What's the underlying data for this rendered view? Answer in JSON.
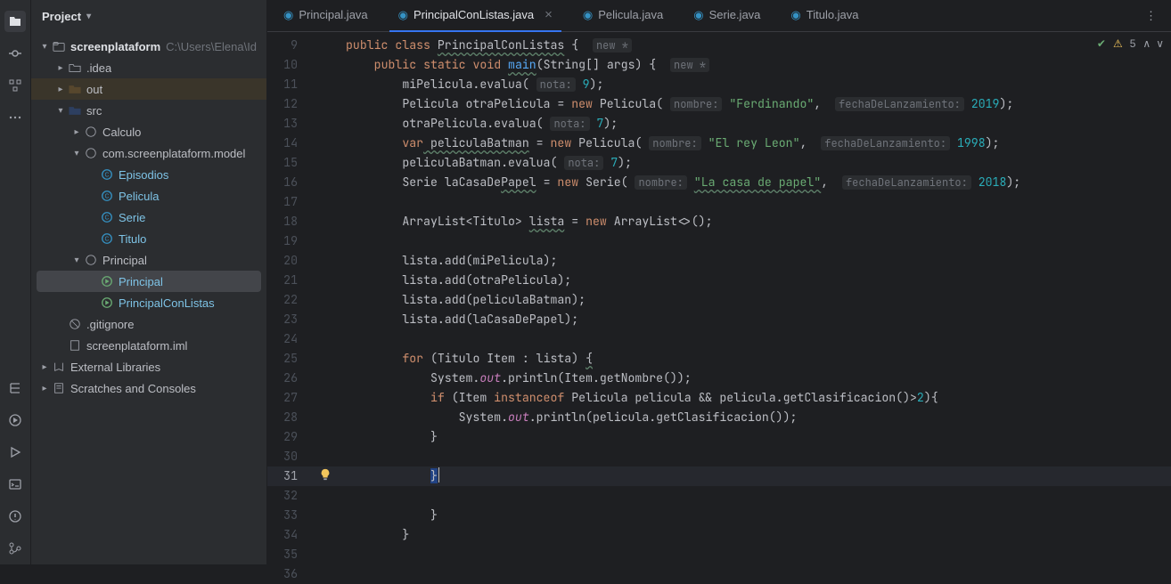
{
  "panel": {
    "title": "Project"
  },
  "tree": {
    "root": {
      "name": "screenplataform",
      "path": "C:\\Users\\Elena\\Id"
    },
    "idea": ".idea",
    "out": "out",
    "src": "src",
    "calculo": "Calculo",
    "model": "com.screenplataform.model",
    "episodios": "Episodios",
    "pelicula": "Pelicula",
    "serie": "Serie",
    "titulo": "Titulo",
    "principalFolder": "Principal",
    "principal": "Principal",
    "princListas": "PrincipalConListas",
    "gitignore": ".gitignore",
    "iml": "screenplataform.iml",
    "extlib": "External Libraries",
    "scratches": "Scratches and Consoles"
  },
  "tabs": {
    "t1": "Principal.java",
    "t2": "PrincipalConListas.java",
    "t3": "Pelicula.java",
    "t4": "Serie.java",
    "t5": "Titulo.java"
  },
  "indicators": {
    "warn_count": "5"
  },
  "hints": {
    "new": "new *",
    "nota": "nota:",
    "nombre": "nombre:",
    "fecha": "fechaDeLanzamiento:"
  },
  "code": {
    "l9a": "public",
    "l9b": "class",
    "l9c": "PrincipalConListas",
    "l9d": " {",
    "l10a": "public",
    "l10b": "static",
    "l10c": "void",
    "l10d": "main",
    "l10e": "(String[] args) {",
    "l11b": "miPelicula.evalua(",
    "l11n": "9",
    "l11c": ");",
    "l12a": "Pelicula otraPelicula = ",
    "l12b": "new",
    "l12c": " Pelicula(",
    "l12s": "\"Ferdinando\"",
    "l12d": ", ",
    "l12n": "2019",
    "l12e": ");",
    "l13a": "otraPelicula.evalua(",
    "l13n": "7",
    "l13b": ");",
    "l14a": "var",
    "l14b": " peliculaBatman",
    "l14c": " = ",
    "l14d": "new",
    "l14e": " Pelicula(",
    "l14s": "\"El rey Leon\"",
    "l14f": ", ",
    "l14n": "1998",
    "l14g": ");",
    "l15a": "peliculaBatman.evalua(",
    "l15n": "7",
    "l15b": ");",
    "l16a": "Serie laCasaDe",
    "l16u": "Papel",
    "l16b": " = ",
    "l16c": "new",
    "l16d": " Serie(",
    "l16s": "\"La casa de papel\"",
    "l16e": ", ",
    "l16n": "2018",
    "l16f": ");",
    "l18a": "ArrayList<Titulo> ",
    "l18u": "lista",
    "l18b": " = ",
    "l18c": "new",
    "l18d": " ArrayList<>();",
    "l20": "lista.add(miPelicula);",
    "l21": "lista.add(otraPelicula);",
    "l22": "lista.add(peliculaBatman);",
    "l23": "lista.add(laCasaDePapel);",
    "l25a": "for",
    "l25b": " (Titulo Item : lista) ",
    "l25c": "{",
    "l26a": "System.",
    "l26b": "out",
    "l26c": ".println(Item.getNombre());",
    "l27a": "if",
    "l27b": " (Item ",
    "l27c": "instanceof",
    "l27d": " Pelicula pelicula && pelicula.getClasificacion()>",
    "l27n": "2",
    "l27e": "){",
    "l28a": "System.",
    "l28b": "out",
    "l28c": ".println(pelicula.getClasificacion());",
    "l29": "}",
    "l31": "}",
    "l33": "}",
    "l34": "}"
  },
  "linenums": [
    "9",
    "10",
    "11",
    "12",
    "13",
    "14",
    "15",
    "16",
    "17",
    "18",
    "19",
    "20",
    "21",
    "22",
    "23",
    "24",
    "25",
    "26",
    "27",
    "28",
    "29",
    "30",
    "31",
    "32",
    "33",
    "34",
    "35",
    "36"
  ]
}
